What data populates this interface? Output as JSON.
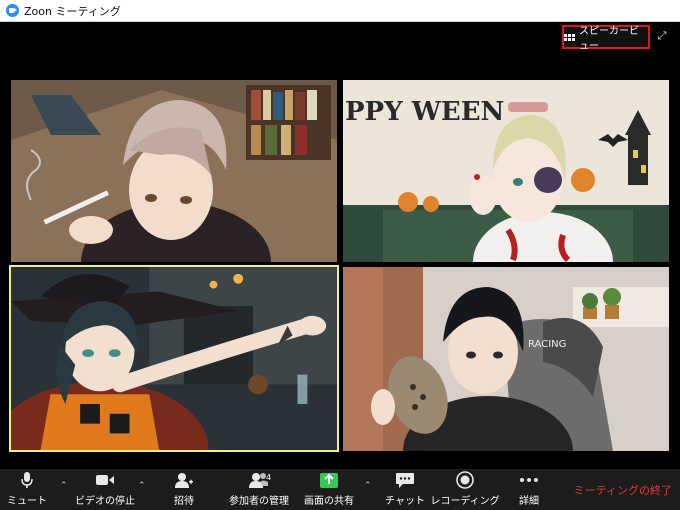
{
  "window": {
    "title": "Zoon ミーティング"
  },
  "stage": {
    "view_button_label": "スピーカービュー"
  },
  "toolbar": {
    "mute_label": "ミュート",
    "video_label": "ビデオの停止",
    "invite_label": "招待",
    "participants_label": "参加者の管理",
    "participants_count": "4",
    "share_label": "画面の共有",
    "chat_label": "チャット",
    "record_label": "レコーディング",
    "more_label": "詳細",
    "end_label": "ミーティングの終了"
  },
  "tiles": [
    {
      "id": "participant-1",
      "description": "brown-haired man with cigarette in library"
    },
    {
      "id": "participant-2",
      "text": "PPY WEEN"
    },
    {
      "id": "participant-3",
      "description": "witch costume, active speaker"
    },
    {
      "id": "participant-4",
      "text": "RACING"
    }
  ],
  "colors": {
    "active_speaker_border": "#f1f07a",
    "end_button": "#e23a3a",
    "highlight_box": "#e0161e",
    "share_icon": "#34c759",
    "app_icon": "#2d8cff"
  }
}
